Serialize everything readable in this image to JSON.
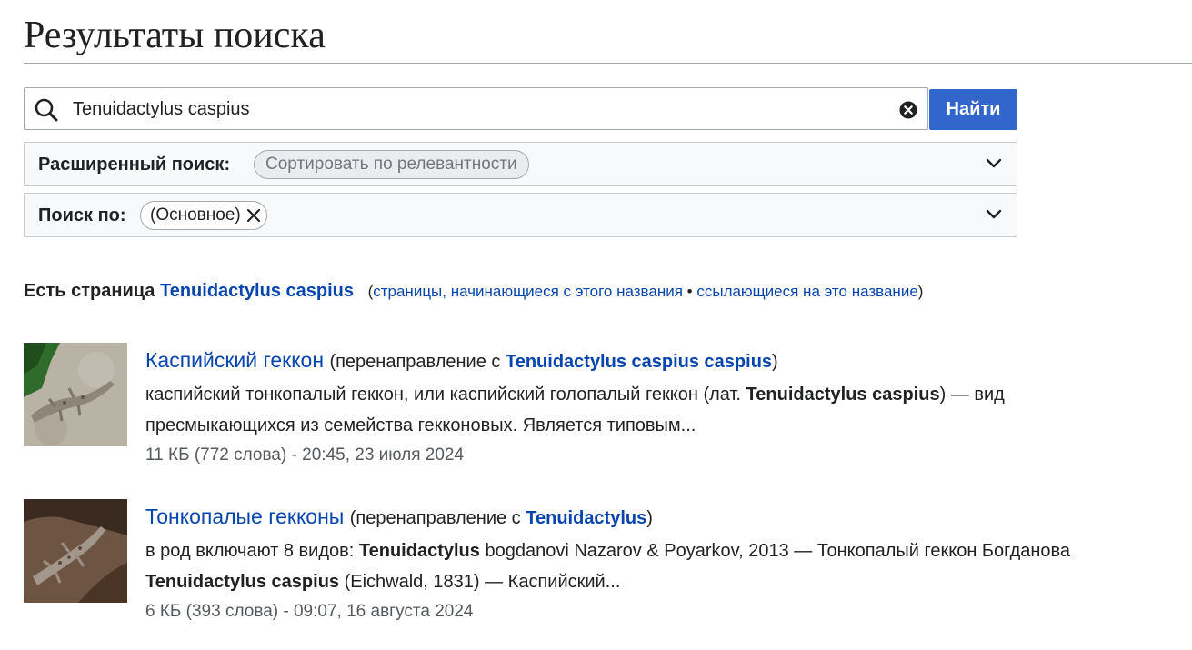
{
  "page": {
    "title": "Результаты поиска"
  },
  "search": {
    "value": "Tenuidactylus caspius",
    "button_label": "Найти"
  },
  "advanced": {
    "label": "Расширенный поиск:",
    "sort_chip": "Сортировать по релевантности"
  },
  "namespace": {
    "label": "Поиск по:",
    "chip": "(Основное)"
  },
  "exists": {
    "prefix": "Есть страница",
    "link": "Tenuidactylus caspius",
    "open_paren": "(",
    "prefix_link": "страницы, начинающиеся с этого названия",
    "separator": "•",
    "links_here": "ссылающиеся на это название",
    "close_paren": ")"
  },
  "results": [
    {
      "title": "Каспийский геккон",
      "redirect_prefix": "(перенаправление с",
      "redirect_link": "Tenuidactylus caspius caspius",
      "redirect_suffix": ")",
      "snippet_line1_a": "каспийский тонкопалый геккон, или каспийский голопалый геккон (лат.",
      "snippet_line1_b": "Tenuidactylus caspius",
      "snippet_line1_c": ") — вид",
      "snippet_line2": "пресмыкающихся из семейства гекконовых. Является типовым...",
      "meta": "11 КБ (772 слова) - 20:45, 23 июля 2024"
    },
    {
      "title": "Тонкопалые гекконы",
      "redirect_prefix": "(перенаправление с",
      "redirect_link": "Tenuidactylus",
      "redirect_suffix": ")",
      "snippet_line1_a": "в род включают 8 видов:",
      "snippet_line1_b": "Tenuidactylus",
      "snippet_line1_c": "bogdanovi Nazarov & Poyarkov, 2013 — Тонкопалый геккон Богданова",
      "snippet_line2_a": "Tenuidactylus caspius",
      "snippet_line2_b": "(Eichwald, 1831) — Каспийский...",
      "meta": "6 КБ (393 слова) - 09:07, 16 августа 2024"
    }
  ]
}
